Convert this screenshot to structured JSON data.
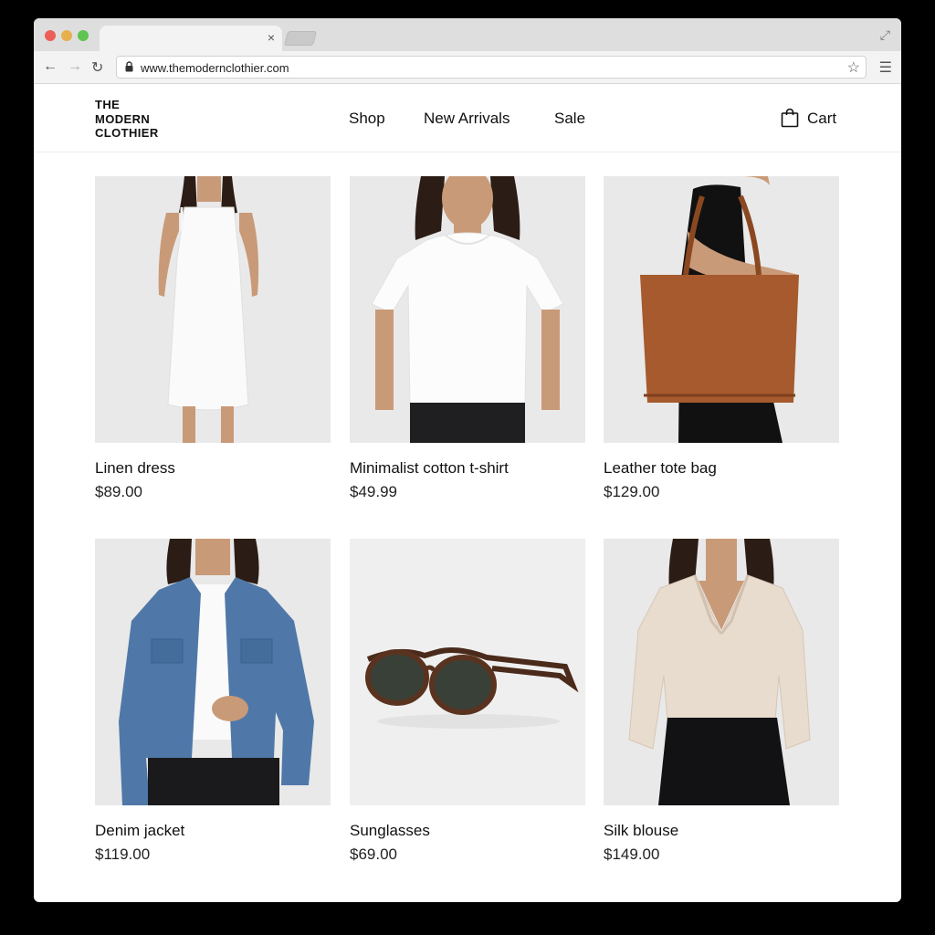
{
  "browser": {
    "url": "www.themodernclothier.com",
    "tab_close": "×",
    "icons": [
      "close-icon",
      "expand-icon",
      "back-icon",
      "forward-icon",
      "reload-icon",
      "lock-icon",
      "star-icon",
      "menu-icon"
    ]
  },
  "site": {
    "logo_lines": [
      "THE",
      "MODERN",
      "CLOTHIER"
    ],
    "nav": [
      "Shop",
      "New Arrivals",
      "Sale"
    ],
    "cart_label": "Cart"
  },
  "products": [
    {
      "name": "Linen dress",
      "price": "$89.00",
      "image": "white-linen-dress-photo"
    },
    {
      "name": "Minimalist cotton t-shirt",
      "price": "$49.99",
      "image": "white-tshirt-photo"
    },
    {
      "name": "Leather tote bag",
      "price": "$129.00",
      "image": "brown-leather-tote-photo"
    },
    {
      "name": "Denim jacket",
      "price": "$119.00",
      "image": "denim-jacket-photo"
    },
    {
      "name": "Sunglasses",
      "price": "$69.00",
      "image": "tortoise-sunglasses-photo"
    },
    {
      "name": "Silk blouse",
      "price": "$149.00",
      "image": "silk-blouse-photo"
    }
  ],
  "colors": {
    "photo_bg": "#e9e9e9",
    "tote_leather": "#a65a2d",
    "denim": "#4f78a8",
    "blouse": "#e8dccf"
  }
}
